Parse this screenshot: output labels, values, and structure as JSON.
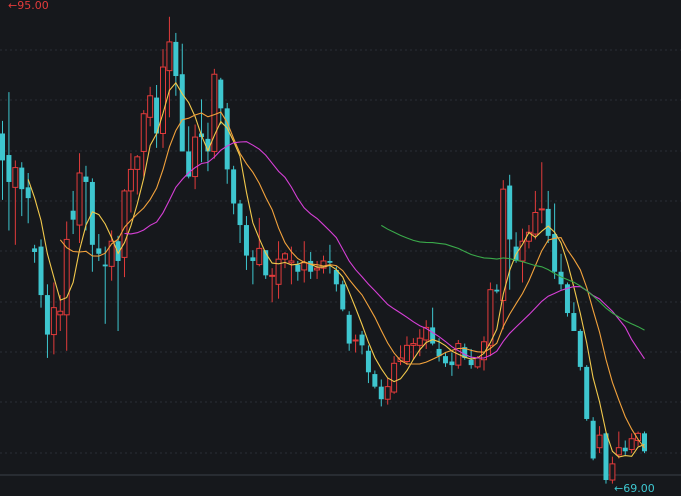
{
  "colors": {
    "background": "#16181c",
    "grid": "#2a2e36",
    "up": "#e23b3b",
    "down": "#3ec6cf",
    "high_label": "#e23b3b",
    "low_label": "#3ec6cf",
    "ma_colors": [
      "#f2c94c",
      "#f2a23c",
      "#d63fd6",
      "#3aa94a"
    ]
  },
  "labels": {
    "high": "←95.00",
    "low": "←69.00"
  },
  "chart_data": {
    "type": "candlestick",
    "ylim": [
      68.7,
      95.6
    ],
    "high_marker": 95.0,
    "low_marker": 69.0,
    "grid": true,
    "ohlc": [
      [
        88.5,
        89.2,
        84.8,
        87.0
      ],
      [
        87.3,
        90.8,
        83.1,
        85.8
      ],
      [
        85.5,
        87.0,
        82.3,
        86.6
      ],
      [
        86.6,
        86.9,
        83.9,
        85.4
      ],
      [
        85.5,
        86.3,
        83.5,
        84.9
      ],
      [
        82.1,
        82.3,
        81.3,
        81.9
      ],
      [
        82.2,
        82.6,
        78.8,
        79.5
      ],
      [
        79.5,
        80.1,
        76.0,
        77.3
      ],
      [
        77.3,
        80.2,
        76.2,
        78.8
      ],
      [
        78.4,
        79.5,
        77.5,
        78.6
      ],
      [
        78.4,
        83.6,
        76.4,
        82.6
      ],
      [
        84.2,
        85.3,
        82.9,
        83.7
      ],
      [
        83.4,
        87.4,
        82.4,
        86.3
      ],
      [
        86.1,
        86.7,
        83.1,
        85.8
      ],
      [
        85.8,
        86.0,
        80.8,
        82.3
      ],
      [
        82.1,
        82.9,
        81.4,
        81.8
      ],
      [
        81.2,
        82.2,
        77.9,
        81.1
      ],
      [
        81.1,
        83.1,
        80.3,
        82.5
      ],
      [
        82.5,
        82.8,
        77.5,
        81.4
      ],
      [
        81.6,
        85.4,
        80.5,
        85.3
      ],
      [
        85.3,
        87.4,
        84.1,
        86.5
      ],
      [
        86.5,
        87.3,
        85.1,
        87.2
      ],
      [
        87.5,
        89.8,
        86.1,
        89.6
      ],
      [
        89.4,
        91.1,
        88.9,
        90.6
      ],
      [
        90.5,
        91.2,
        87.7,
        88.5
      ],
      [
        88.5,
        93.2,
        87.7,
        92.2
      ],
      [
        92.0,
        95.0,
        89.4,
        93.6
      ],
      [
        93.6,
        94.1,
        90.6,
        91.7
      ],
      [
        91.8,
        93.5,
        87.5,
        87.5
      ],
      [
        87.5,
        88.9,
        86.0,
        86.1
      ],
      [
        86.1,
        89.0,
        85.4,
        88.3
      ],
      [
        88.5,
        90.4,
        86.9,
        88.3
      ],
      [
        88.2,
        89.1,
        86.4,
        87.5
      ],
      [
        87.5,
        92.1,
        87.1,
        91.8
      ],
      [
        91.5,
        91.6,
        89.0,
        89.9
      ],
      [
        89.9,
        90.2,
        85.7,
        86.5
      ],
      [
        86.5,
        86.7,
        84.0,
        84.6
      ],
      [
        84.6,
        84.8,
        82.4,
        83.4
      ],
      [
        83.4,
        83.9,
        80.9,
        81.7
      ],
      [
        81.6,
        82.0,
        80.1,
        81.4
      ],
      [
        81.2,
        83.8,
        81.1,
        82.1
      ],
      [
        82.0,
        82.0,
        80.4,
        80.6
      ],
      [
        80.6,
        81.0,
        79.1,
        80.6
      ],
      [
        80.1,
        82.5,
        79.3,
        81.5
      ],
      [
        81.5,
        81.9,
        81.0,
        81.8
      ],
      [
        81.3,
        82.2,
        80.1,
        81.4
      ],
      [
        81.2,
        81.4,
        80.3,
        80.8
      ],
      [
        80.9,
        82.5,
        80.2,
        81.3
      ],
      [
        81.4,
        81.9,
        80.4,
        80.8
      ],
      [
        80.9,
        81.4,
        80.4,
        81.0
      ],
      [
        81.0,
        81.7,
        80.7,
        81.4
      ],
      [
        81.4,
        82.3,
        80.7,
        81.3
      ],
      [
        80.9,
        81.1,
        79.7,
        80.1
      ],
      [
        80.1,
        80.3,
        78.6,
        78.7
      ],
      [
        78.4,
        78.6,
        76.4,
        76.8
      ],
      [
        77.0,
        77.3,
        76.3,
        77.0
      ],
      [
        77.3,
        77.5,
        76.2,
        76.7
      ],
      [
        76.4,
        76.7,
        74.6,
        75.2
      ],
      [
        75.1,
        75.3,
        74.3,
        74.4
      ],
      [
        74.4,
        74.8,
        73.3,
        73.7
      ],
      [
        73.7,
        74.9,
        73.4,
        74.4
      ],
      [
        74.1,
        76.1,
        74.0,
        75.7
      ],
      [
        75.8,
        76.7,
        75.6,
        76.0
      ],
      [
        75.8,
        77.2,
        75.6,
        76.7
      ],
      [
        76.7,
        77.1,
        75.9,
        76.8
      ],
      [
        76.7,
        77.6,
        76.1,
        77.1
      ],
      [
        77.0,
        78.1,
        76.5,
        77.7
      ],
      [
        77.7,
        78.8,
        76.7,
        76.8
      ],
      [
        76.5,
        77.1,
        75.8,
        76.1
      ],
      [
        76.1,
        76.3,
        75.5,
        75.7
      ],
      [
        75.8,
        76.3,
        75.0,
        75.6
      ],
      [
        75.6,
        77.0,
        75.4,
        76.8
      ],
      [
        76.6,
        76.8,
        75.9,
        76.0
      ],
      [
        75.9,
        76.5,
        75.4,
        75.6
      ],
      [
        75.5,
        76.1,
        75.4,
        76.0
      ],
      [
        75.9,
        77.2,
        75.3,
        76.9
      ],
      [
        76.7,
        80.2,
        76.1,
        79.8
      ],
      [
        79.8,
        80.1,
        79.6,
        79.7
      ],
      [
        79.2,
        85.9,
        77.6,
        85.4
      ],
      [
        85.6,
        86.2,
        79.8,
        82.6
      ],
      [
        82.2,
        83.0,
        81.3,
        81.4
      ],
      [
        81.4,
        83.2,
        80.2,
        82.5
      ],
      [
        82.5,
        83.4,
        82.1,
        83.0
      ],
      [
        82.9,
        85.3,
        82.6,
        84.1
      ],
      [
        84.3,
        86.9,
        83.5,
        84.3
      ],
      [
        84.3,
        85.3,
        82.4,
        82.8
      ],
      [
        82.9,
        84.6,
        80.4,
        80.8
      ],
      [
        80.8,
        81.8,
        79.8,
        80.1
      ],
      [
        80.1,
        80.2,
        78.3,
        78.5
      ],
      [
        78.5,
        79.1,
        77.5,
        77.5
      ],
      [
        77.5,
        77.6,
        75.3,
        75.5
      ],
      [
        75.5,
        75.6,
        72.5,
        72.6
      ],
      [
        72.5,
        72.7,
        70.3,
        70.4
      ],
      [
        71.0,
        72.2,
        70.7,
        71.7
      ],
      [
        71.8,
        71.9,
        69.0,
        69.2
      ],
      [
        69.2,
        70.5,
        69.0,
        70.1
      ],
      [
        70.6,
        71.9,
        70.4,
        71.0
      ],
      [
        71.0,
        71.4,
        70.6,
        70.8
      ],
      [
        70.9,
        71.8,
        70.7,
        71.5
      ],
      [
        71.4,
        71.9,
        71.1,
        71.8
      ],
      [
        71.8,
        71.9,
        70.7,
        70.8
      ]
    ]
  }
}
